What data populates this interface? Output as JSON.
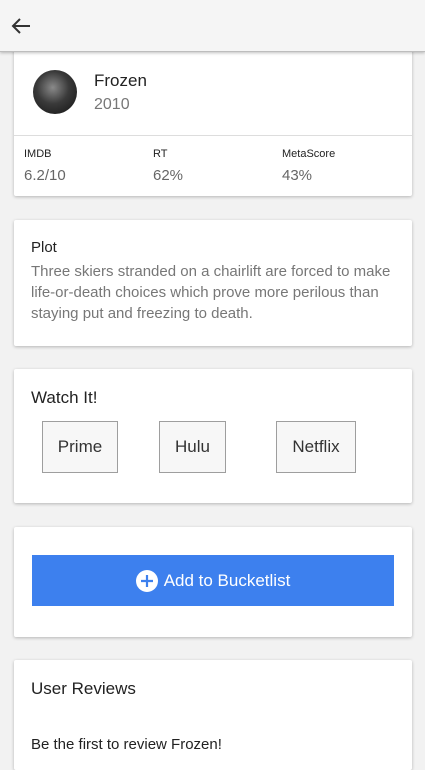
{
  "movie": {
    "title": "Frozen",
    "year": "2010",
    "ratings": [
      {
        "label": "IMDB",
        "value": "6.2/10"
      },
      {
        "label": "RT",
        "value": "62%"
      },
      {
        "label": "MetaScore",
        "value": "43%"
      }
    ]
  },
  "plot": {
    "heading": "Plot",
    "text": "Three skiers stranded on a chairlift are forced to make life-or-death choices which prove more perilous than staying put and freezing to death."
  },
  "watch": {
    "heading": "Watch It!",
    "services": [
      "Prime",
      "Hulu",
      "Netflix"
    ]
  },
  "bucketlist": {
    "button_label": "Add to Bucketlist",
    "icon": "plus-circle-icon",
    "color": "#3d80ee"
  },
  "reviews": {
    "heading": "User Reviews",
    "empty_text": "Be the first to review Frozen!"
  },
  "nav": {
    "back_icon": "arrow-left-icon"
  }
}
